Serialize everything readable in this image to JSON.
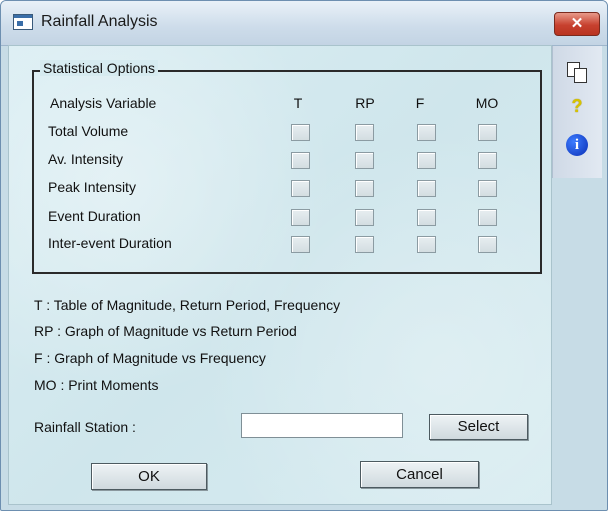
{
  "window": {
    "title": "Rainfall Analysis",
    "close_glyph": "✕"
  },
  "toolbar": {
    "icons": [
      "copy-icon",
      "help-icon",
      "info-icon"
    ],
    "help_glyph": "?",
    "info_glyph": "i"
  },
  "stats": {
    "group_title": "Statistical Options",
    "row_header": "Analysis Variable",
    "columns": [
      "T",
      "RP",
      "F",
      "MO"
    ],
    "rows": [
      "Total Volume",
      "Av. Intensity",
      "Peak Intensity",
      "Event Duration",
      "Inter-event Duration"
    ]
  },
  "legend": [
    "T : Table of Magnitude, Return Period, Frequency",
    "RP : Graph of Magnitude vs Return Period",
    "F : Graph of Magnitude vs Frequency",
    "MO : Print Moments"
  ],
  "station": {
    "label": "Rainfall Station :",
    "value": "",
    "select_label": "Select"
  },
  "buttons": {
    "ok": "OK",
    "cancel": "Cancel"
  },
  "colors": {
    "title_bar": "#cddcea",
    "close_button": "#c7412f",
    "client_bg": "#d6ebf0",
    "side_toolbar": "#d9e2ed"
  }
}
